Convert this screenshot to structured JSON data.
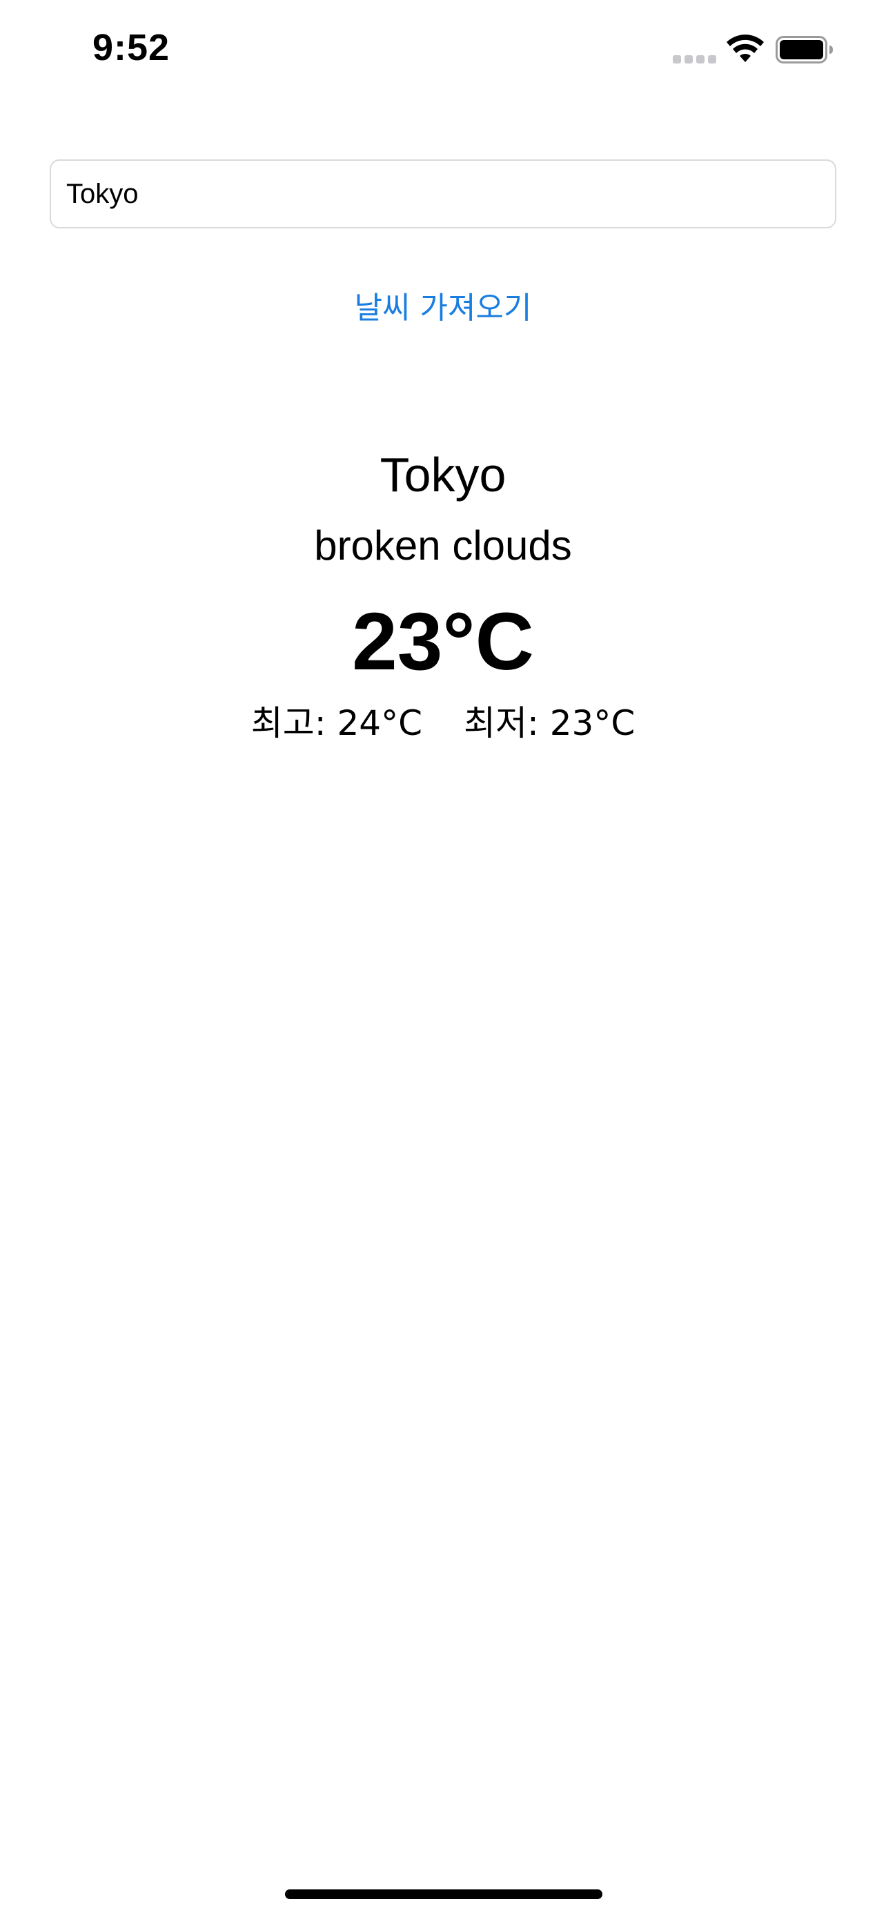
{
  "status_bar": {
    "time": "9:52",
    "wifi_icon": "wifi-icon",
    "battery_icon": "battery-full-icon",
    "signal_icon": "cellular-signal-dots-icon"
  },
  "search": {
    "value": "Tokyo"
  },
  "fetch_button": {
    "label": "날씨 가져오기",
    "color": "#1a7de0"
  },
  "weather": {
    "city": "Tokyo",
    "condition": "broken clouds",
    "temperature": "23°C",
    "high": "최고: 24°C",
    "low": "최저: 23°C"
  }
}
